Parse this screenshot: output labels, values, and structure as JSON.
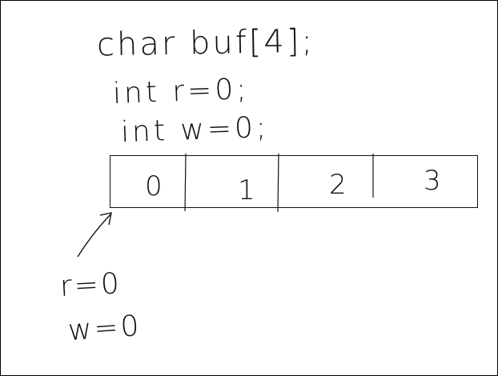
{
  "code": {
    "line1": "char buf[4];",
    "line2": "int r=0;",
    "line3": "int w=0;"
  },
  "buffer": {
    "cells": [
      "0",
      "1",
      "2",
      "3"
    ]
  },
  "pointers": {
    "r_label": "r=0",
    "w_label": "w=0"
  },
  "colors": {
    "ink": "#111111",
    "background": "#ffffff"
  }
}
